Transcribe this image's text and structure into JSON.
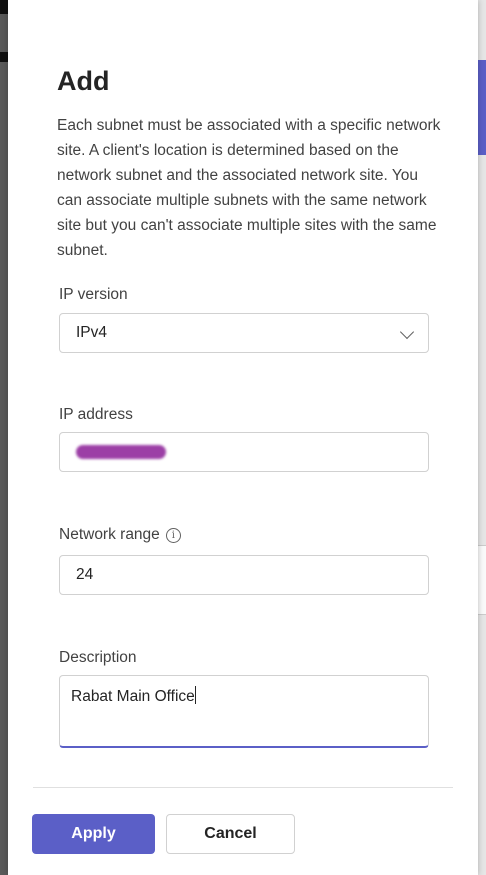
{
  "dialog": {
    "title": "Add",
    "description": "Each subnet must be associated with a specific network site. A client's location is determined based on the network subnet and the associated network site. You can associate multiple subnets with the same network site but you can't associate multiple sites with the same subnet."
  },
  "fields": {
    "ip_version": {
      "label": "IP version",
      "value": "IPv4"
    },
    "ip_address": {
      "label": "IP address",
      "value": ""
    },
    "network_range": {
      "label": "Network range",
      "value": "24",
      "info_icon": "info-icon"
    },
    "description": {
      "label": "Description",
      "value": "Rabat Main Office"
    }
  },
  "actions": {
    "apply_label": "Apply",
    "cancel_label": "Cancel"
  },
  "colors": {
    "accent": "#5b5fc7",
    "redaction": "#9c3fa6"
  }
}
